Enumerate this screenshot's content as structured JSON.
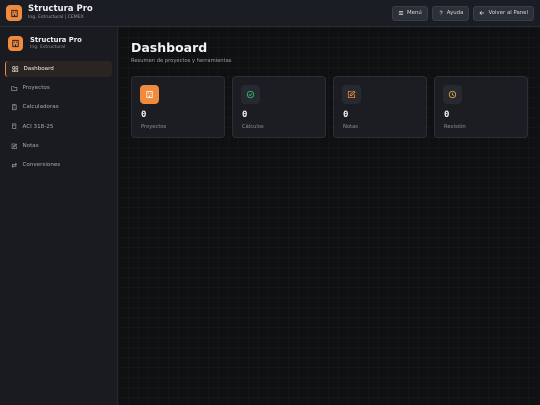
{
  "colors": {
    "accent": "#f08a3c",
    "green": "#35c46e",
    "yellow": "#e8b33a",
    "background": "#0f1012",
    "panel": "#191b20"
  },
  "topbar": {
    "title": "Structura Pro",
    "subtitle": "Ing. Estructural | CEMEX",
    "buttons": [
      {
        "label": "Menú",
        "icon": "menu-icon"
      },
      {
        "label": "Ayuda",
        "icon": "help-icon"
      },
      {
        "label": "Volver al Panel",
        "icon": "arrow-left-icon"
      }
    ]
  },
  "sidebar": {
    "title": "Structura Pro",
    "subtitle": "Ing. Estructural",
    "items": [
      {
        "label": "Dashboard",
        "icon": "grid-icon",
        "active": true
      },
      {
        "label": "Proyectos",
        "icon": "folder-icon"
      },
      {
        "label": "Calculadoras",
        "icon": "calculator-icon"
      },
      {
        "label": "ACI 318-25",
        "icon": "book-icon"
      },
      {
        "label": "Notas",
        "icon": "edit-icon"
      },
      {
        "label": "Conversiones",
        "icon": "swap-icon"
      }
    ]
  },
  "main": {
    "title": "Dashboard",
    "subtitle": "Resumen de proyectos y herramientas",
    "cards": [
      {
        "value": "0",
        "label": "Proyectos",
        "icon": "building-icon"
      },
      {
        "value": "0",
        "label": "Cálculos",
        "icon": "check-circle-icon"
      },
      {
        "value": "0",
        "label": "Notas",
        "icon": "edit-icon"
      },
      {
        "value": "0",
        "label": "Revisión",
        "icon": "clock-icon"
      }
    ]
  }
}
